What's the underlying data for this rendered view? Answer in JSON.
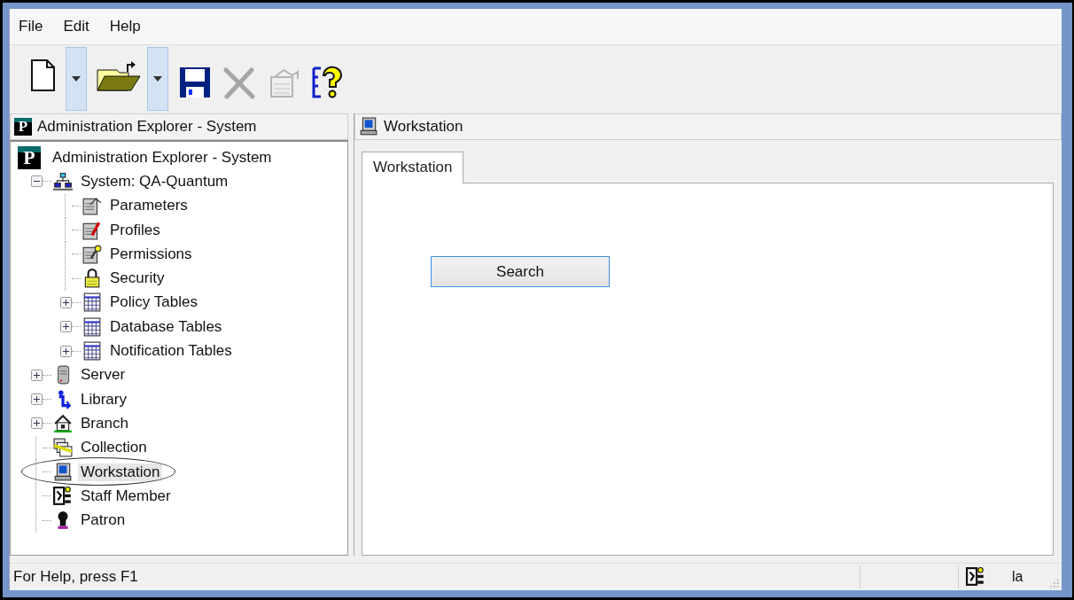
{
  "menu": [
    {
      "label": "File"
    },
    {
      "label": "Edit"
    },
    {
      "label": "Help"
    }
  ],
  "toolbar": [
    {
      "kind": "new",
      "dropdown": true,
      "disabled": false
    },
    {
      "kind": "open",
      "dropdown": true,
      "disabled": false
    },
    {
      "kind": "save",
      "dropdown": false,
      "disabled": false
    },
    {
      "kind": "delete",
      "dropdown": false,
      "disabled": true
    },
    {
      "kind": "properties",
      "dropdown": false,
      "disabled": true
    },
    {
      "kind": "help",
      "dropdown": false,
      "disabled": false
    }
  ],
  "left_panel": {
    "logo": "P",
    "title": "Administration Explorer - System"
  },
  "tree": {
    "logo": "P",
    "label": "Administration Explorer - System",
    "children": [
      {
        "label": "System: QA-Quantum",
        "expanded": true,
        "selected": false,
        "children": [
          {
            "label": "Parameters",
            "selected": false
          },
          {
            "label": "Profiles",
            "selected": false
          },
          {
            "label": "Permissions",
            "selected": false
          },
          {
            "label": "Security",
            "selected": false
          },
          {
            "label": "Policy Tables",
            "expanded": false,
            "selected": false
          },
          {
            "label": "Database Tables",
            "expanded": false,
            "selected": false
          },
          {
            "label": "Notification Tables",
            "expanded": false,
            "selected": false
          }
        ]
      },
      {
        "label": "Server",
        "expanded": false,
        "selected": false
      },
      {
        "label": "Library",
        "expanded": false,
        "selected": false
      },
      {
        "label": "Branch",
        "expanded": false,
        "selected": false
      },
      {
        "label": "Collection",
        "selected": false
      },
      {
        "label": "Workstation",
        "selected": true
      },
      {
        "label": "Staff Member",
        "selected": false
      },
      {
        "label": "Patron",
        "selected": false
      }
    ]
  },
  "right_panel": {
    "title": "Workstation",
    "tabs": [
      {
        "label": "Workstation",
        "selected": true
      }
    ],
    "button": "Search"
  },
  "status_bar": {
    "text": "For Help, press F1",
    "indicator": "la"
  }
}
